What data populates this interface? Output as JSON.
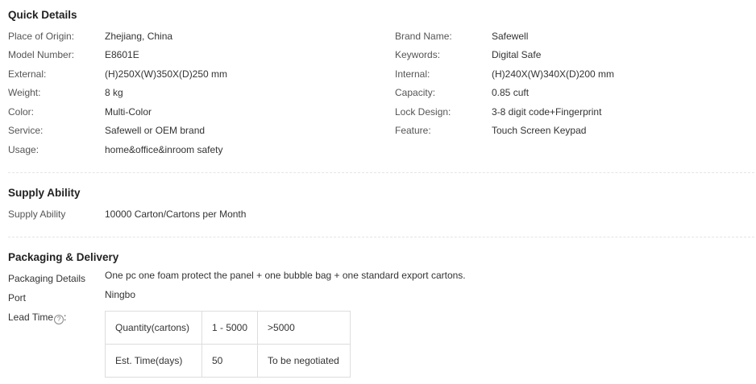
{
  "quick_details": {
    "title": "Quick Details",
    "left": [
      {
        "label": "Place of Origin:",
        "value": "Zhejiang, China"
      },
      {
        "label": "Model Number:",
        "value": "E8601E"
      },
      {
        "label": "External:",
        "value": "(H)250X(W)350X(D)250 mm"
      },
      {
        "label": "Weight:",
        "value": "8 kg"
      },
      {
        "label": "Color:",
        "value": "Multi-Color"
      },
      {
        "label": "Service:",
        "value": "Safewell or OEM brand"
      },
      {
        "label": "Usage:",
        "value": "home&office&inroom safety"
      }
    ],
    "right": [
      {
        "label": "Brand Name:",
        "value": "Safewell"
      },
      {
        "label": "Keywords:",
        "value": "Digital Safe"
      },
      {
        "label": "Internal:",
        "value": "(H)240X(W)340X(D)200 mm"
      },
      {
        "label": "Capacity:",
        "value": "0.85 cuft"
      },
      {
        "label": "Lock Design:",
        "value": "3-8 digit code+Fingerprint"
      },
      {
        "label": "Feature:",
        "value": "Touch Screen Keypad"
      }
    ]
  },
  "supply_ability": {
    "title": "Supply Ability",
    "label": "Supply Ability",
    "value": "10000 Carton/Cartons per Month"
  },
  "packaging": {
    "title": "Packaging & Delivery",
    "details_label": "Packaging Details",
    "details_value": "One pc one foam protect the panel + one bubble bag + one standard export cartons.",
    "port_label": "Port",
    "port_value": "Ningbo",
    "lead_time_label": "Lead Time",
    "help_glyph": "?",
    "help_suffix": ":",
    "help_icon": "question-circle-icon",
    "lead_table": {
      "rows": [
        [
          "Quantity(cartons)",
          "1 - 5000",
          ">5000"
        ],
        [
          "Est. Time(days)",
          "50",
          "To be negotiated"
        ]
      ]
    }
  }
}
